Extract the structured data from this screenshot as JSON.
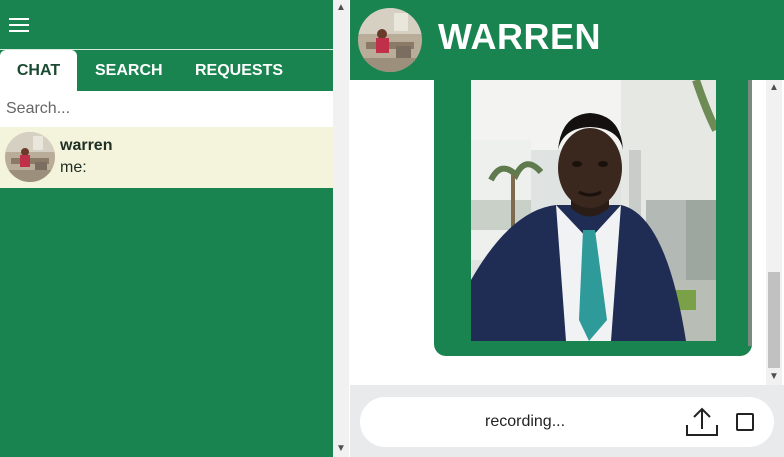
{
  "sidebar": {
    "menu_icon": "hamburger-menu-icon",
    "tabs": [
      {
        "label": "CHAT",
        "active": true
      },
      {
        "label": "SEARCH",
        "active": false
      },
      {
        "label": "REQUESTS",
        "active": false
      }
    ],
    "search": {
      "placeholder": "Search...",
      "value": ""
    },
    "chats": [
      {
        "name": "warren",
        "preview": "me:"
      }
    ]
  },
  "conversation": {
    "contact_name": "WARREN",
    "message_type": "image"
  },
  "composer": {
    "status_text": "recording...",
    "upload_icon": "upload-icon",
    "stop_icon": "stop-icon"
  },
  "colors": {
    "primary_green": "#1a8450",
    "chat_item_bg": "#f4f4dc",
    "composer_bg": "#e8eaec"
  }
}
